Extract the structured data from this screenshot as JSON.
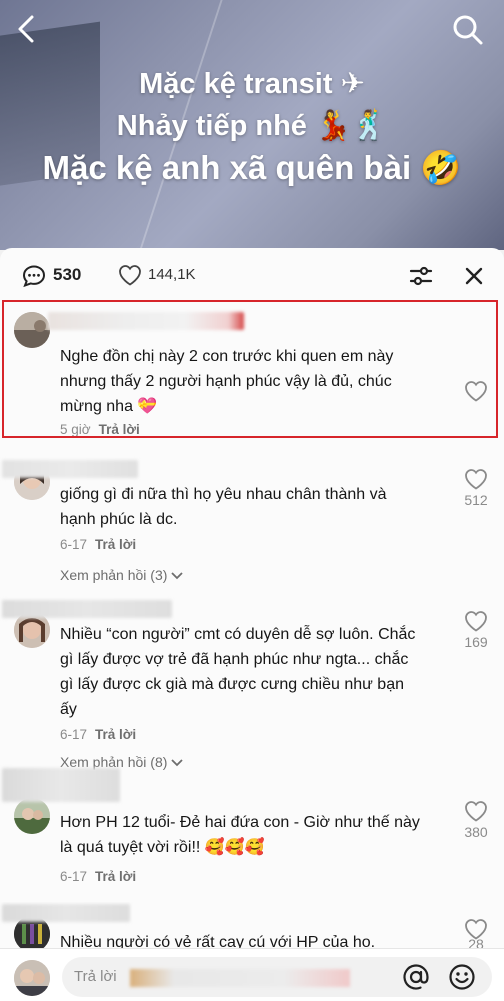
{
  "video": {
    "caption_lines": [
      "Mặc kệ transit",
      "Nhảy tiếp nhé",
      "Mặc kệ anh xã quên bài"
    ],
    "caption_emojis": [
      "✈",
      "💃🕺",
      "🤣"
    ]
  },
  "sheet": {
    "comment_count": "530",
    "like_count": "144,1K"
  },
  "comments": [
    {
      "text": "Nghe đồn chị này 2 con trước khi quen em này nhưng thấy 2 người hạnh phúc vậy là đủ, chúc mừng nha 💝",
      "time": "5 giờ",
      "reply_label": "Trả lời",
      "likes": "",
      "view_replies": "",
      "highlighted": true
    },
    {
      "text": "giống gì đi nữa thì họ yêu nhau chân thành và hạnh phúc là dc.",
      "time": "6-17",
      "reply_label": "Trả lời",
      "likes": "512",
      "view_replies": "Xem phản hồi (3)"
    },
    {
      "text": "Nhiều “con người” cmt có duyên dễ sợ luôn. Chắc gì lấy được vợ trẻ đã hạnh phúc như ngta... chắc gì lấy được ck già mà được cưng chiều như bạn ấy",
      "time": "6-17",
      "reply_label": "Trả lời",
      "likes": "169",
      "view_replies": "Xem phản hồi (8)"
    },
    {
      "text": "Hơn PH 12 tuổi- Đẻ hai đứa con - Giờ như thế này là quá tuyệt vời rồi!! 🥰🥰🥰",
      "time": "6-17",
      "reply_label": "Trả lời",
      "likes": "380",
      "view_replies": ""
    },
    {
      "text": "Nhiều người có vẻ rất cay cú với HP của họ.",
      "time": "",
      "reply_label": "",
      "likes": "28",
      "view_replies": ""
    }
  ],
  "input": {
    "placeholder": "Trả lời"
  },
  "colors": {
    "highlight_border": "#d7252b",
    "sheet_bg": "#fbfbfb"
  }
}
